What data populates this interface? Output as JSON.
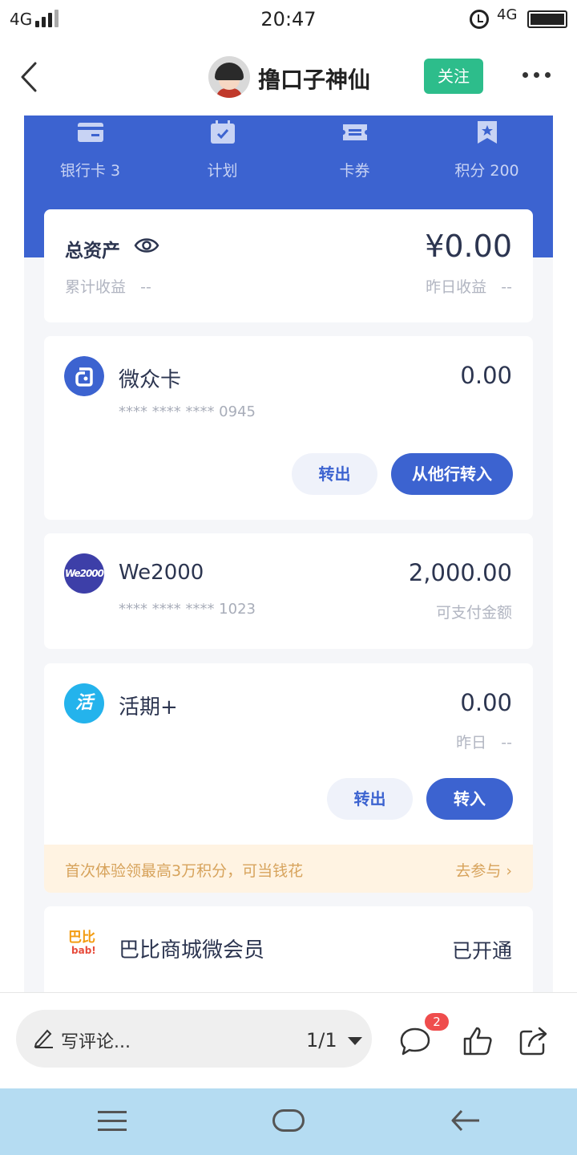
{
  "status_bar": {
    "network": "4G",
    "time": "20:47",
    "network_right": "4G"
  },
  "header": {
    "username": "撸口子神仙",
    "follow_label": "关注"
  },
  "nav": [
    {
      "label": "银行卡 3",
      "icon": "card-icon"
    },
    {
      "label": "计划",
      "icon": "calendar-icon"
    },
    {
      "label": "卡券",
      "icon": "ticket-icon"
    },
    {
      "label": "积分 200",
      "icon": "bookmark-star-icon"
    }
  ],
  "total": {
    "title": "总资产",
    "value": "¥0.00",
    "cumulative_label": "累计收益",
    "cumulative_value": "--",
    "yesterday_label": "昨日收益",
    "yesterday_value": "--"
  },
  "accounts": {
    "weizhong": {
      "name": "微众卡",
      "value": "0.00",
      "number": "**** **** **** 0945",
      "transfer_out": "转出",
      "transfer_in": "从他行转入"
    },
    "we2000": {
      "name": "We2000",
      "value": "2,000.00",
      "number": "**** **** **** 1023",
      "sub": "可支付金额",
      "icon_text": "We2000"
    },
    "huoqi": {
      "name": "活期+",
      "value": "0.00",
      "yesterday_label": "昨日",
      "yesterday_value": "--",
      "transfer_out": "转出",
      "transfer_in": "转入",
      "icon_text": "活"
    },
    "babi": {
      "name": "巴比商城微会员",
      "status": "已开通",
      "logo_top": "巴比",
      "logo_bottom": "bab!"
    }
  },
  "promo": {
    "text": "首次体验领最高3万积分，可当钱花",
    "action": "去参与 ›"
  },
  "bottom_bar": {
    "comment_placeholder": "写评论...",
    "page_indicator": "1/1",
    "comment_badge": "2"
  }
}
